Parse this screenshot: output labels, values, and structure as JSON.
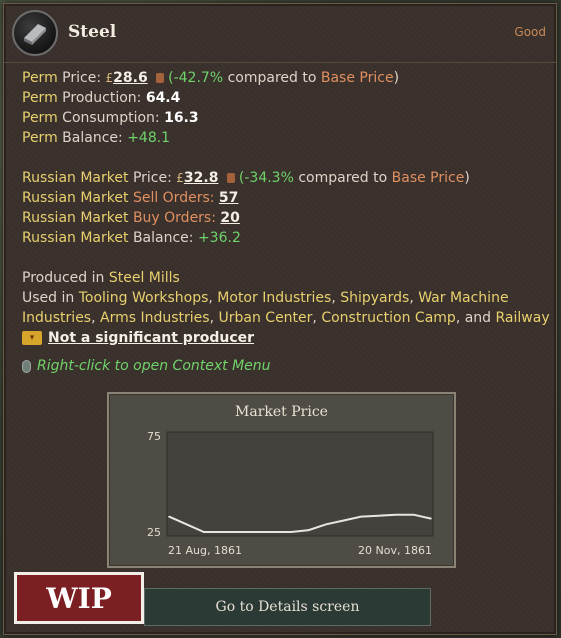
{
  "header": {
    "title": "Steel",
    "category": "Good",
    "icon": "steel-ingot-icon"
  },
  "perm": {
    "price_prefix": "Perm",
    "price_label": "Price:",
    "price_value": "28.6",
    "price_change": "(-42.7%",
    "compared_to": "compared to",
    "base_price": "Base Price",
    "close_paren": ")",
    "production_label": "Production:",
    "production_value": "64.4",
    "consumption_label": "Consumption:",
    "consumption_value": "16.3",
    "balance_label": "Balance:",
    "balance_value": "+48.1"
  },
  "market": {
    "name": "Russian Market",
    "price_label": "Price:",
    "price_value": "32.8",
    "price_change": "(-34.3%",
    "compared_to": "compared to",
    "base_price": "Base Price",
    "close_paren": ")",
    "sell_label": "Sell Orders:",
    "sell_value": "57",
    "buy_label": "Buy Orders:",
    "buy_value": "20",
    "balance_label": "Balance:",
    "balance_value": "+36.2"
  },
  "production": {
    "produced_in_label": "Produced in",
    "produced_in": "Steel Mills",
    "used_in_label": "Used in",
    "used_in": [
      "Tooling Workshops",
      "Motor Industries",
      "Shipyards",
      "War Machine Industries",
      "Arms Industries",
      "Urban Center",
      "Construction Camp"
    ],
    "used_in_and": "and",
    "used_in_last": "Railway",
    "not_significant": "Not a significant producer"
  },
  "context_hint": "Right-click to open Context Menu",
  "chart_data": {
    "type": "line",
    "title": "Market Price",
    "x_labels": [
      "21 Aug, 1861",
      "20 Nov, 1861"
    ],
    "ylim": [
      25,
      75
    ],
    "y_ticks": [
      75,
      25
    ],
    "values": [
      33,
      29,
      25,
      25,
      25,
      25,
      25,
      25,
      26,
      29,
      31,
      33,
      33.5,
      34,
      34,
      32
    ],
    "grid": false
  },
  "details_button": "Go to Details screen",
  "watermark": "WIP",
  "colors": {
    "accent_yellow": "#e8d16e",
    "accent_orange": "#e09060",
    "positive_green": "#6fd46a"
  }
}
